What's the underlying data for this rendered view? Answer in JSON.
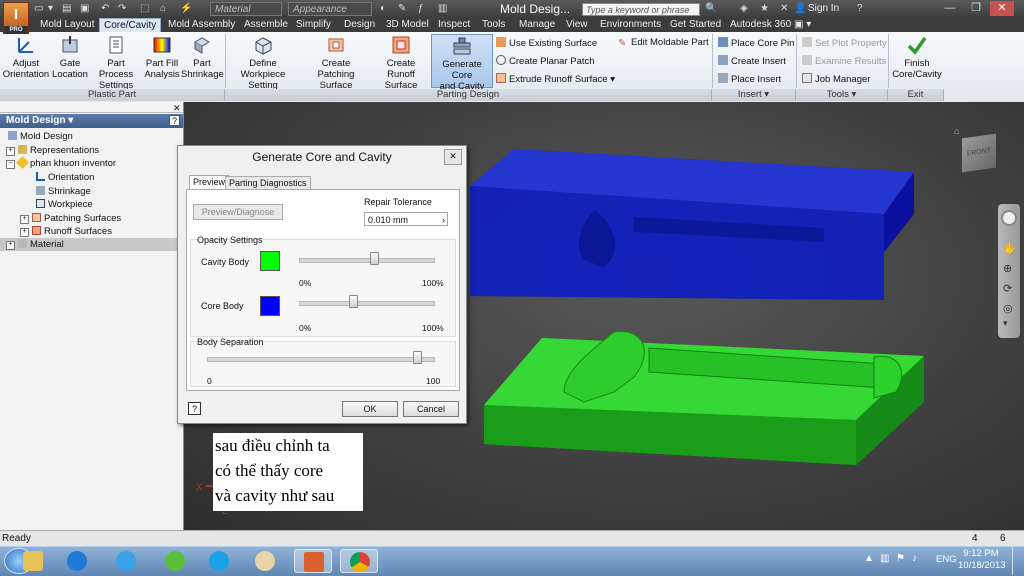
{
  "app": {
    "logo_letter": "I",
    "logo_sub": "PRO",
    "document_title": "Mold Desig...",
    "search_placeholder": "Type a keyword or phrase",
    "sign_in": "Sign In",
    "quick_material": "Material",
    "quick_appearance": "Appearance"
  },
  "tabs": [
    "Mold Layout",
    "Core/Cavity",
    "Mold Assembly",
    "Assemble",
    "Simplify",
    "Design",
    "3D Model",
    "Inspect",
    "Tools",
    "Manage",
    "View",
    "Environments",
    "Get Started",
    "Autodesk 360"
  ],
  "active_tab": "Core/Cavity",
  "ribbon": {
    "plastic_part": {
      "label": "Plastic Part",
      "buttons": [
        [
          "Adjust",
          "Orientation"
        ],
        [
          "Gate",
          "Location"
        ],
        [
          "Part Process",
          "Settings"
        ],
        [
          "Part Fill",
          "Analysis"
        ],
        [
          "Part",
          "Shrinkage"
        ]
      ]
    },
    "parting_design": {
      "label": "Parting Design",
      "buttons": [
        [
          "Define Workpiece",
          "Setting"
        ],
        [
          "Create",
          "Patching Surface"
        ],
        [
          "Create Runoff",
          "Surface"
        ],
        [
          "Generate Core",
          "and Cavity"
        ]
      ],
      "small": [
        "Use Existing Surface",
        "Create Planar Patch",
        "Extrude Runoff Surface",
        "Edit Moldable Part"
      ]
    },
    "insert": {
      "label": "Insert ▾",
      "small": [
        "Place Core Pin",
        "Create Insert",
        "Place Insert"
      ]
    },
    "tools": {
      "label": "Tools ▾",
      "small": [
        "Set Plot Property",
        "Examine Results",
        "Job Manager"
      ]
    },
    "exit": {
      "label": "Exit",
      "button": [
        "Finish",
        "Core/Cavity"
      ]
    }
  },
  "browser": {
    "header": "Mold Design ▾",
    "items": [
      "Mold Design",
      "Representations",
      "phan khuon inventor",
      "Orientation",
      "Shrinkage",
      "Workpiece",
      "Patching Surfaces",
      "Runoff Surfaces",
      "Material"
    ]
  },
  "dialog": {
    "title": "Generate Core and Cavity",
    "tabs": [
      "Preview",
      "Parting Diagnostics"
    ],
    "preview_button": "Preview/Diagnose",
    "repair_tolerance_label": "Repair Tolerance",
    "repair_tolerance_value": "0.010 mm",
    "opacity_label": "Opacity Settings",
    "cavity_label": "Cavity Body",
    "core_label": "Core Body",
    "pct_min": "0%",
    "pct_max": "100%",
    "separation_label": "Body Separation",
    "sep_min": "0",
    "sep_max": "100",
    "cavity_opacity": 0.55,
    "core_opacity": 0.4,
    "body_separation": 0.92,
    "cavity_color": "#00ff00",
    "core_color": "#0000ff",
    "ok": "OK",
    "cancel": "Cancel",
    "help": "?"
  },
  "caption": [
    "sau điều chỉnh ta",
    "có thể thấy core",
    "và cavity như sau"
  ],
  "viewcube_label": "FRONT",
  "axis": {
    "x": "X",
    "z": "Z"
  },
  "status": {
    "text": "Ready",
    "n1": "4",
    "n2": "6"
  },
  "taskbar": {
    "lang": "ENG",
    "time": "9:12 PM",
    "date": "10/18/2013"
  }
}
